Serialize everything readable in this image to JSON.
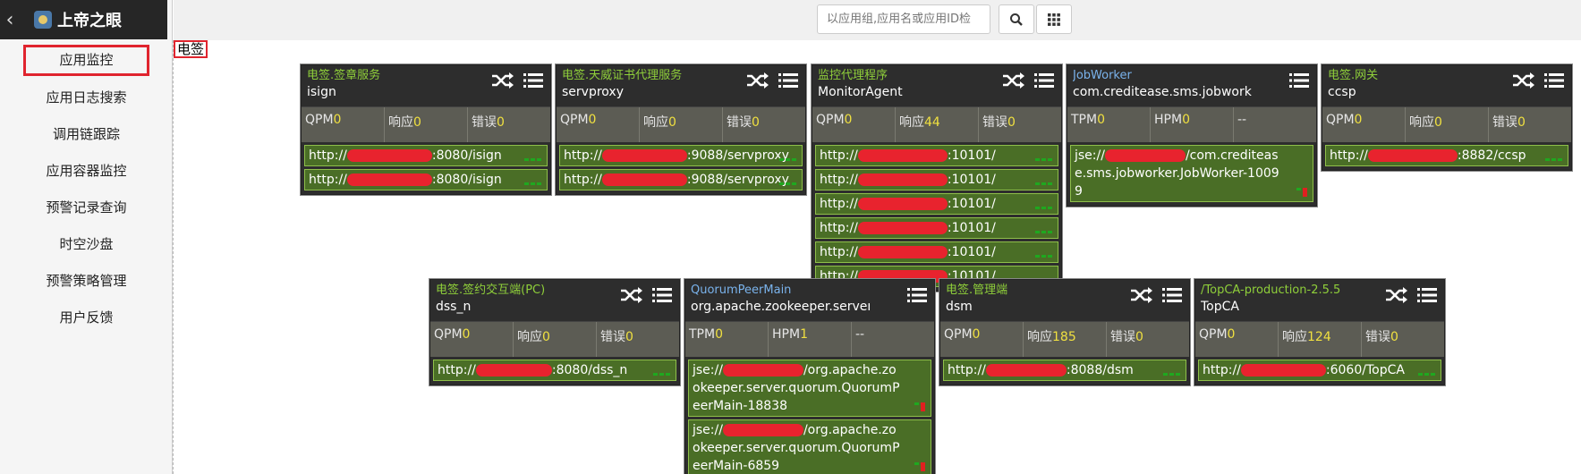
{
  "app": {
    "title": "上帝之眼"
  },
  "sidebar": {
    "items": [
      {
        "label": "应用监控"
      },
      {
        "label": "应用日志搜索"
      },
      {
        "label": "调用链跟踪"
      },
      {
        "label": "应用容器监控"
      },
      {
        "label": "预警记录查询"
      },
      {
        "label": "时空沙盘"
      },
      {
        "label": "预警策略管理"
      },
      {
        "label": "用户反馈"
      }
    ]
  },
  "search": {
    "placeholder": "以应用组,应用名或应用ID检"
  },
  "group_label": "电签",
  "colors": {
    "accent": "#e0242e",
    "card": "#2d2d2d",
    "instance": "#4a6e26",
    "metric_value": "#f0e040"
  },
  "cards": [
    {
      "group": "电签.签章服务",
      "app": "isign",
      "metrics": [
        [
          "QPM",
          "0"
        ],
        [
          "响应",
          "0"
        ],
        [
          "错误",
          "0"
        ]
      ],
      "instances": [
        [
          "http://",
          ":8080/isign"
        ],
        [
          "http://",
          ":8080/isign"
        ]
      ]
    },
    {
      "group": "电签.天威证书代理服务",
      "app": "servproxy",
      "metrics": [
        [
          "QPM",
          "0"
        ],
        [
          "响应",
          "0"
        ],
        [
          "错误",
          "0"
        ]
      ],
      "instances": [
        [
          "http://",
          ":9088/servproxy"
        ],
        [
          "http://",
          ":9088/servproxy"
        ]
      ]
    },
    {
      "group": "监控代理程序",
      "app": "MonitorAgent",
      "metrics": [
        [
          "QPM",
          "0"
        ],
        [
          "响应",
          "44"
        ],
        [
          "错误",
          "0"
        ]
      ],
      "instances": [
        [
          "http://",
          ":10101/"
        ],
        [
          "http://",
          ":10101/"
        ],
        [
          "http://",
          ":10101/"
        ],
        [
          "http://",
          ":10101/"
        ],
        [
          "http://",
          ":10101/"
        ],
        [
          "http://",
          ":10101/"
        ]
      ]
    },
    {
      "group": "JobWorker",
      "app": "com.creditease.sms.jobworker",
      "metrics": [
        [
          "TPM",
          "0"
        ],
        [
          "HPM",
          "0"
        ],
        [
          "--",
          ""
        ]
      ],
      "instances": [
        [
          "jse://",
          "/com.creditease.sms.jobworker.JobWorker-10099"
        ]
      ]
    },
    {
      "group": "电签.网关",
      "app": "ccsp",
      "metrics": [
        [
          "QPM",
          "0"
        ],
        [
          "响应",
          "0"
        ],
        [
          "错误",
          "0"
        ]
      ],
      "instances": [
        [
          "http://",
          ":8882/ccsp"
        ]
      ]
    },
    {
      "group": "电签.签约交互端(PC)",
      "app": "dss_n",
      "metrics": [
        [
          "QPM",
          "0"
        ],
        [
          "响应",
          "0"
        ],
        [
          "错误",
          "0"
        ]
      ],
      "instances": [
        [
          "http://",
          ":8080/dss_n"
        ]
      ]
    },
    {
      "group": "QuorumPeerMain",
      "app": "org.apache.zookeeper.server",
      "metrics": [
        [
          "TPM",
          "0"
        ],
        [
          "HPM",
          "1"
        ],
        [
          "--",
          ""
        ]
      ],
      "instances": [
        [
          "jse://",
          "/org.apache.zookeeper.server.quorum.QuorumPeerMain-18838"
        ],
        [
          "jse://",
          "/org.apache.zookeeper.server.quorum.QuorumPeerMain-6859"
        ]
      ]
    },
    {
      "group": "电签.管理端",
      "app": "dsm",
      "metrics": [
        [
          "QPM",
          "0"
        ],
        [
          "响应",
          "185"
        ],
        [
          "错误",
          "0"
        ]
      ],
      "instances": [
        [
          "http://",
          ":8088/dsm"
        ]
      ]
    },
    {
      "group": "/TopCA-production-2.5.5",
      "app": "TopCA",
      "metrics": [
        [
          "QPM",
          "0"
        ],
        [
          "响应",
          "124"
        ],
        [
          "错误",
          "0"
        ]
      ],
      "instances": [
        [
          "http://",
          ":6060/TopCA"
        ]
      ]
    }
  ]
}
